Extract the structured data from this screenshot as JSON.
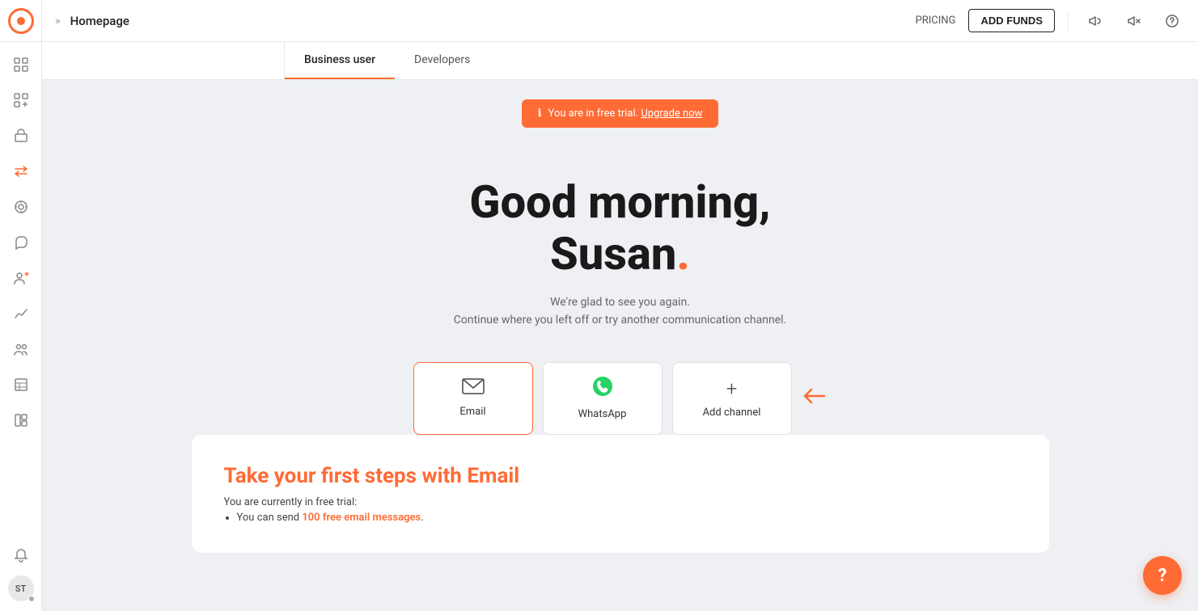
{
  "app": {
    "logo_alt": "App Logo"
  },
  "topnav": {
    "chevron": "»",
    "title": "Homepage",
    "pricing_label": "PRICING",
    "add_funds_label": "ADD FUNDS"
  },
  "tabs": [
    {
      "label": "Business user",
      "active": true
    },
    {
      "label": "Developers",
      "active": false
    }
  ],
  "alert": {
    "icon": "ℹ",
    "text": "You are in free trial.",
    "link_text": "Upgrade now"
  },
  "hero": {
    "greeting": "Good morning,",
    "name": "Susan",
    "dot": ".",
    "subtitle_line1": "We're glad to see you again.",
    "subtitle_line2": "Continue where you left off or try another communication channel."
  },
  "channels": [
    {
      "id": "email",
      "label": "Email",
      "icon_type": "email",
      "selected": true
    },
    {
      "id": "whatsapp",
      "label": "WhatsApp",
      "icon_type": "whatsapp",
      "selected": false
    },
    {
      "id": "add",
      "label": "Add channel",
      "icon_type": "add",
      "selected": false
    }
  ],
  "steps_section": {
    "title_prefix": "Take your first steps with ",
    "title_channel": "Email",
    "desc_intro": "You are currently in free trial:",
    "bullet_1_prefix": "You can send ",
    "bullet_1_count": "100 free email messages",
    "bullet_1_suffix": "."
  },
  "help": {
    "label": "?"
  },
  "sidebar_icons": [
    {
      "name": "grid-icon",
      "unicode": "⊞",
      "active": false
    },
    {
      "name": "add-grid-icon",
      "unicode": "⊞",
      "active": false
    },
    {
      "name": "shop-icon",
      "unicode": "🏪",
      "active": false
    },
    {
      "name": "exchange-icon",
      "unicode": "⇌",
      "active": true
    },
    {
      "name": "target-icon",
      "unicode": "◎",
      "active": false
    },
    {
      "name": "chat-icon",
      "unicode": "💬",
      "active": false
    },
    {
      "name": "users-icon",
      "unicode": "👥",
      "active": false
    },
    {
      "name": "analytics-icon",
      "unicode": "📈",
      "active": false
    },
    {
      "name": "audience-icon",
      "unicode": "👤",
      "active": false
    },
    {
      "name": "table-icon",
      "unicode": "▦",
      "active": false
    },
    {
      "name": "grid2-icon",
      "unicode": "⊟",
      "active": false
    }
  ]
}
